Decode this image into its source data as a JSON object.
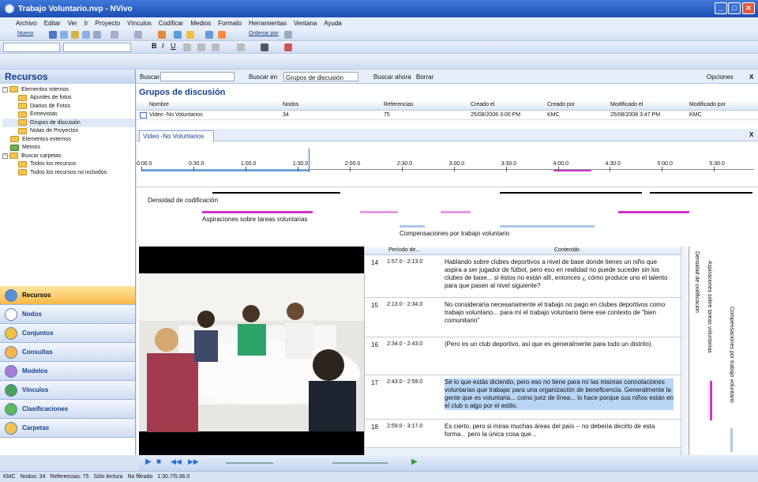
{
  "app": {
    "title": "Trabajo Voluntario.nvp - NVivo"
  },
  "menu": [
    "Archivo",
    "Editar",
    "Ver",
    "Ir",
    "Proyecto",
    "Vínculos",
    "Codificar",
    "Medios",
    "Formato",
    "Herramientas",
    "Ventana",
    "Ayuda"
  ],
  "toolbar": {
    "new_label": "Nuevo",
    "sort_label": "Ordenar por"
  },
  "left": {
    "title": "Recursos",
    "tree": {
      "internal": "Elementos internos",
      "children": [
        "Apuntes de fotos",
        "Diarios de Fotos",
        "Entrevistas",
        "Grupos de discusión",
        "Notas de Proyectos"
      ],
      "external": "Elementos externos",
      "memos": "Memos",
      "search": "Buscar carpetas",
      "search_children": [
        "Todos los recursos",
        "Todos los recursos no incluidos"
      ]
    },
    "nav": [
      "Recursos",
      "Nodos",
      "Conjuntos",
      "Consultas",
      "Modelos",
      "Vínculos",
      "Clasificaciones",
      "Carpetas"
    ]
  },
  "findbar": {
    "label": "Buscar:",
    "search_in": "Buscar en",
    "search_in_value": "Grupos de discusión",
    "search_now": "Buscar ahora",
    "clear": "Borrar",
    "options": "Opciones",
    "close": "X"
  },
  "list": {
    "title": "Grupos de discusión",
    "headers": [
      "Nombre",
      "Nodos",
      "Referencias",
      "Creado el",
      "Creado por",
      "Modificado el",
      "Modificado por"
    ],
    "row": [
      "Video -No Voluntarios",
      "34",
      "75",
      "25/08/2008 3:00 PM",
      "KMC",
      "25/08/2008 3:47 PM",
      "KMC"
    ]
  },
  "tab": {
    "label": "Video -No Voluntarios",
    "close": "X"
  },
  "timeline": {
    "ticks": [
      "0:00.0",
      "0:30.0",
      "1:00.0",
      "1:30.0",
      "2:00.0",
      "2:30.0",
      "3:00.0",
      "3:30.0",
      "4:00.0",
      "4:30.0",
      "5:00.0",
      "5:30.0"
    ]
  },
  "coding": {
    "density": "Densidad de codificación",
    "stripe1": "Aspiraciones sobre tareas voluntarias",
    "stripe2": "Compensaciones por trabajo voluntario"
  },
  "grid": {
    "headers": [
      "Período de...",
      "Contenido"
    ],
    "rows": [
      {
        "n": "14",
        "period": "1:57.0 - 2:13.0",
        "text": "Hablando sobre clubes deportivos a nivel de base donde tienes un niño que aspira a ser jugador de fútbol, pero eso en realidad no puede suceder sin los clubes de base... si éstos no están allí, entonces ¿ cómo produce uno el talento para que pasen al nivel siguiente?"
      },
      {
        "n": "15",
        "period": "2:13.0 - 2:34.0",
        "text": "No consideraría necesariamente el  trabajo no pago en clubes deportivos como trabajo voluntario... para mí el trabajo voluntario tiene ese contexto de \"bien comunitario\""
      },
      {
        "n": "16",
        "period": "2:34.0 - 2:43.0",
        "text": "(Pero es un club deportivo, así que es generalmente para todo un distrito)."
      },
      {
        "n": "17",
        "period": "2:43.0 - 2:59.0",
        "text": "Sé lo que estás diciendo, pero eso no tiene para mí las mismas connotaciones voluntarias que trabajar para una organización de beneficencia. Generalmente la gente que es voluntaria... como juez de línea... lo hace porque sus niños están en el club o algo por el estilo."
      },
      {
        "n": "18",
        "period": "2:59.0 - 3:17.0",
        "text": "Es cierto, pero si miras muchas áreas del país -- no debería decirlo de esta forma... pero la única cosa que..."
      }
    ]
  },
  "status": {
    "user": "KMC",
    "nodes": "Nodos: 34",
    "refs": "Referencias: 75",
    "readonly": "Sólo lectura",
    "filter": "No filtrado",
    "time": "1:30.7/5:36.0"
  },
  "colors": {
    "magenta": "#d633c8",
    "selection": "#b9d6f7",
    "accent": "#15428b"
  }
}
